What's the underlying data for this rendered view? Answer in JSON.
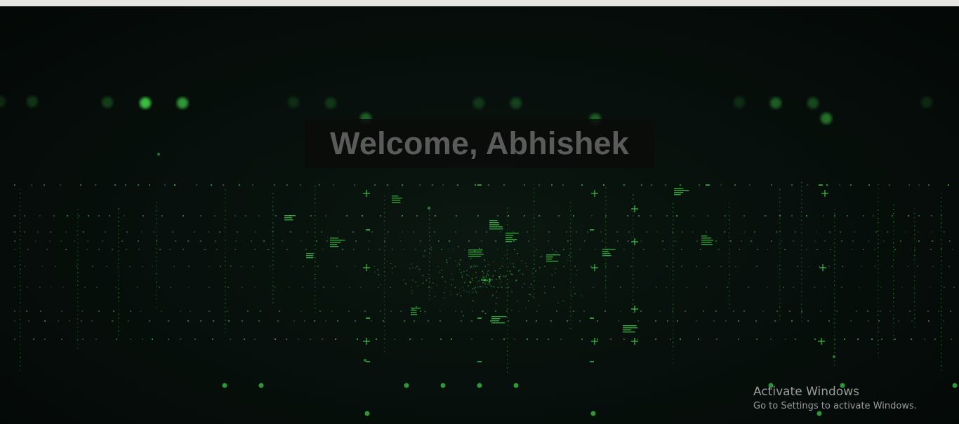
{
  "page": {
    "welcome_heading": "Welcome, Abhishek"
  },
  "watermark": {
    "title": "Activate Windows",
    "subtitle": "Go to Settings to activate Windows."
  },
  "colors": {
    "background": "#050a08",
    "accent_green": "#3fd24a",
    "heading_text": "#5b5b5b",
    "top_strip": "#e7e5e1"
  }
}
